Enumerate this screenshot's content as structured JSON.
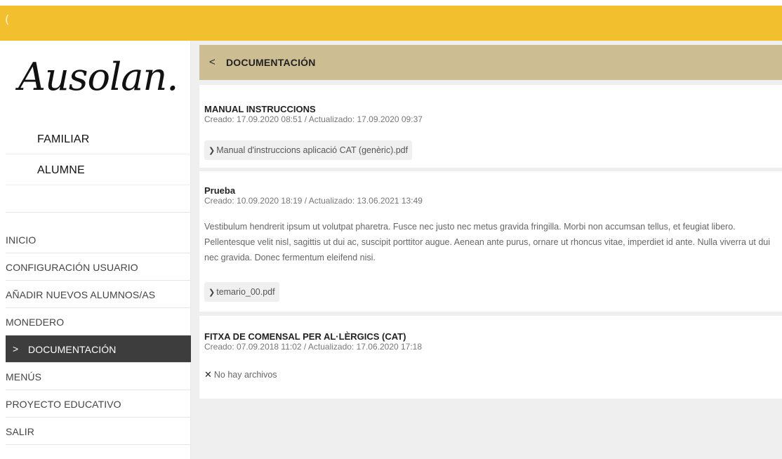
{
  "topbar": {
    "back_glyph": "("
  },
  "sidebar": {
    "logo": "Ausolan.",
    "profile": [
      {
        "label": "FAMILIAR"
      },
      {
        "label": "ALUMNE"
      }
    ],
    "nav": [
      {
        "label": "INICIO"
      },
      {
        "label": "CONFIGURACIÓN USUARIO"
      },
      {
        "label": "AÑADIR NUEVOS ALUMNOS/AS"
      },
      {
        "label": "MONEDERO"
      },
      {
        "label": "DOCUMENTACIÓN",
        "active": true
      },
      {
        "label": "MENÚS"
      },
      {
        "label": "PROYECTO EDUCATIVO"
      },
      {
        "label": "SALIR"
      }
    ]
  },
  "header": {
    "back_icon": "chevron-left-icon",
    "title": "DOCUMENTACIÓN"
  },
  "documents": [
    {
      "title": "MANUAL INSTRUCCIONS",
      "meta": "Creado: 17.09.2020 08:51 / Actualizado: 17.09.2020 09:37",
      "description": "",
      "attachment": "Manual d'instruccions aplicació CAT (genèric).pdf"
    },
    {
      "title": "Prueba",
      "meta": "Creado: 10.09.2020 18:19 / Actualizado: 13.06.2021 13:49",
      "description": "Vestibulum hendrerit ipsum ut volutpat pharetra. Fusce nec justo nec metus gravida fringilla. Morbi non accumsan tellus, et feugiat libero. Pellentesque velit nisl, sagittis ut dui ac, suscipit porttitor augue. Aenean ante purus, ornare ut rhoncus vitae, imperdiet id ante. Nulla viverra ut dui nec gravida. Donec fermentum eleifend nisi.",
      "attachment": "temario_00.pdf"
    },
    {
      "title": "FITXA DE COMENSAL PER AL·LÈRGICS (CAT)",
      "meta": "Creado: 07.09.2018 11:02 / Actualizado: 17.06.2020 17:18",
      "description": "",
      "no_files": "No hay archivos"
    }
  ],
  "colors": {
    "topbar": "#f2bf2e",
    "header": "#cdbd93",
    "active_nav": "#3d3d3d",
    "content_bg": "#efefef"
  }
}
